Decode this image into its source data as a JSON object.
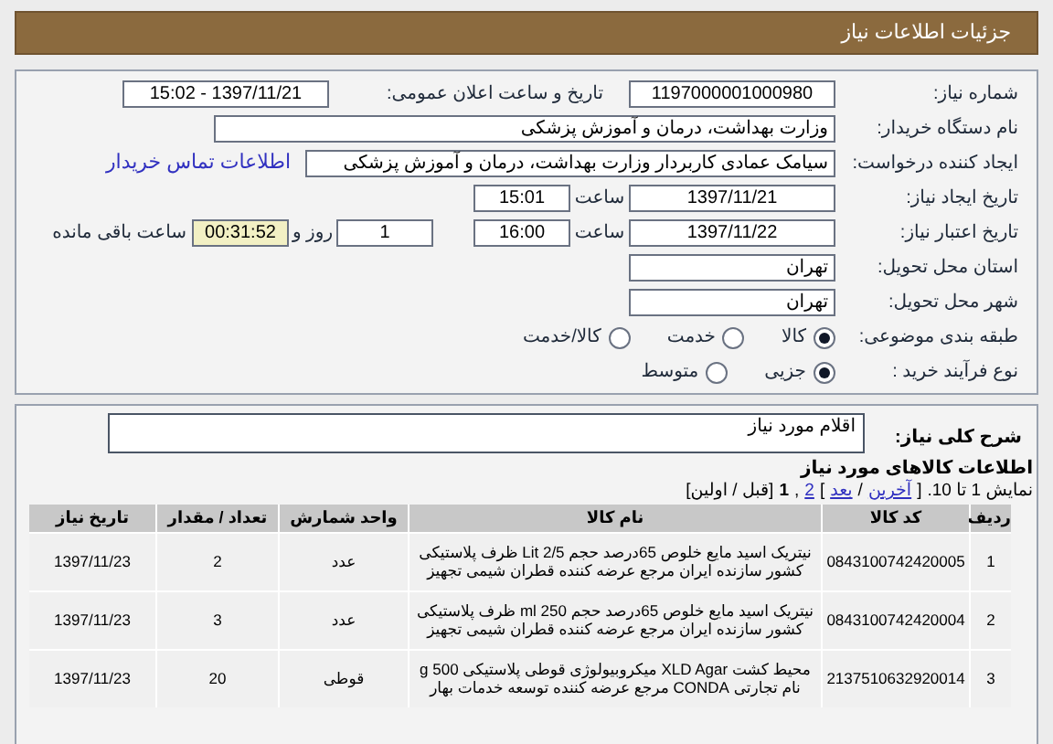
{
  "header": {
    "title": "جزئیات اطلاعات نیاز"
  },
  "form": {
    "need_number": {
      "label": "شماره نیاز:",
      "value": "1197000001000980"
    },
    "announce": {
      "label": "تاریخ و ساعت اعلان عمومی:",
      "value": "1397/11/21 - 15:02"
    },
    "buyer": {
      "label": "نام دستگاه خریدار:",
      "value": "وزارت بهداشت، درمان و آموزش پزشکی"
    },
    "requester": {
      "label": "ایجاد کننده درخواست:",
      "value": "سیامک عمادی کاربردار وزارت بهداشت، درمان و آموزش پزشکی",
      "link": "اطلاعات تماس خریدار"
    },
    "created": {
      "label": "تاریخ ایجاد نیاز:",
      "date": "1397/11/21",
      "time_label": "ساعت",
      "time": "15:01"
    },
    "valid": {
      "label": "تاریخ اعتبار نیاز:",
      "date": "1397/11/22",
      "time_label": "ساعت",
      "time": "16:00",
      "days": "1",
      "days_label": "روز و",
      "remaining": "00:31:52",
      "remaining_label": "ساعت باقی مانده"
    },
    "province": {
      "label": "استان محل تحویل:",
      "value": "تهران"
    },
    "city": {
      "label": "شهر محل تحویل:",
      "value": "تهران"
    },
    "category": {
      "label": "طبقه بندی موضوعی:",
      "options": [
        {
          "label": "کالا",
          "selected": true
        },
        {
          "label": "خدمت",
          "selected": false
        },
        {
          "label": "کالا/خدمت",
          "selected": false
        }
      ]
    },
    "process": {
      "label": "نوع فرآیند خرید :",
      "options": [
        {
          "label": "جزیی",
          "selected": true
        },
        {
          "label": "متوسط",
          "selected": false
        }
      ]
    }
  },
  "description": {
    "label": "شرح کلی نیاز:",
    "value": "اقلام مورد نیاز"
  },
  "goods": {
    "title": "اطلاعات کالاهای مورد نیاز",
    "pager": {
      "summary": "نمایش 1 تا 10.",
      "items": [
        {
          "text": "[",
          "kind": "plain"
        },
        {
          "text": "آخرین",
          "kind": "link"
        },
        {
          "text": "/",
          "kind": "plain"
        },
        {
          "text": "بعد",
          "kind": "link"
        },
        {
          "text": "]",
          "kind": "plain"
        },
        {
          "text": "2",
          "kind": "link"
        },
        {
          "text": ",",
          "kind": "plain"
        },
        {
          "text": "1",
          "kind": "current"
        },
        {
          "text": "[قبل / اولین]",
          "kind": "plain"
        }
      ]
    },
    "columns": [
      "ردیف",
      "کد کالا",
      "نام کالا",
      "واحد شمارش",
      "تعداد / مقدار",
      "تاریخ نیاز"
    ],
    "rows": [
      [
        "1",
        "0843100742420005",
        "نیتریک اسید مایع خلوص 65درصد حجم Lit 2/5 ظرف پلاستیکی کشور سازنده ایران مرجع عرضه کننده قطران شیمی تجهیز",
        "عدد",
        "2",
        "1397/11/23"
      ],
      [
        "2",
        "0843100742420004",
        "نیتریک اسید مایع خلوص 65درصد حجم ml 250 ظرف پلاستیکی کشور سازنده ایران مرجع عرضه کننده قطران شیمی تجهیز",
        "عدد",
        "3",
        "1397/11/23"
      ],
      [
        "3",
        "2137510632920014",
        "محیط کشت XLD Agar میکروبیولوژی قوطی پلاستیکی 500 g نام تجارتی CONDA مرجع عرضه کننده توسعه خدمات بهار",
        "قوطی",
        "20",
        "1397/11/23"
      ]
    ]
  }
}
